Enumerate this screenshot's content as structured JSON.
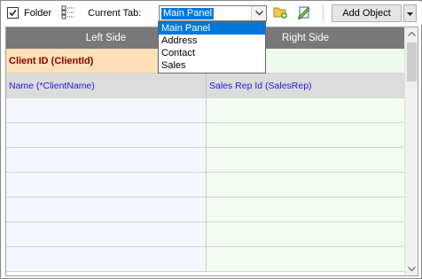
{
  "toolbar": {
    "folder_label": "Folder",
    "folder_checked": true,
    "current_tab_label": "Current Tab:",
    "current_tab_value": "Main Panel",
    "add_object_label": "Add Object",
    "icons": [
      "checkbox-check-icon",
      "tree-view-icon",
      "chevron-down-icon",
      "folder-add-icon",
      "edit-document-icon",
      "dropdown-arrow-icon"
    ]
  },
  "dropdown": {
    "options": [
      "Main Panel",
      "Address",
      "Contact",
      "Sales"
    ],
    "selected_index": 0
  },
  "grid": {
    "left_header": "Left Side",
    "right_header": "Right Side",
    "left_key": "Client ID (ClientId)",
    "right_key": "",
    "left_field": "Name (*ClientName)",
    "right_field": "Sales Rep Id (SalesRep)",
    "empty_rows": 7
  },
  "colors": {
    "header_bg": "#787878",
    "key_left_bg": "#fde0b8",
    "key_left_text": "#8b0000",
    "field_text": "#1a1ae6",
    "selection": "#0078d7"
  }
}
